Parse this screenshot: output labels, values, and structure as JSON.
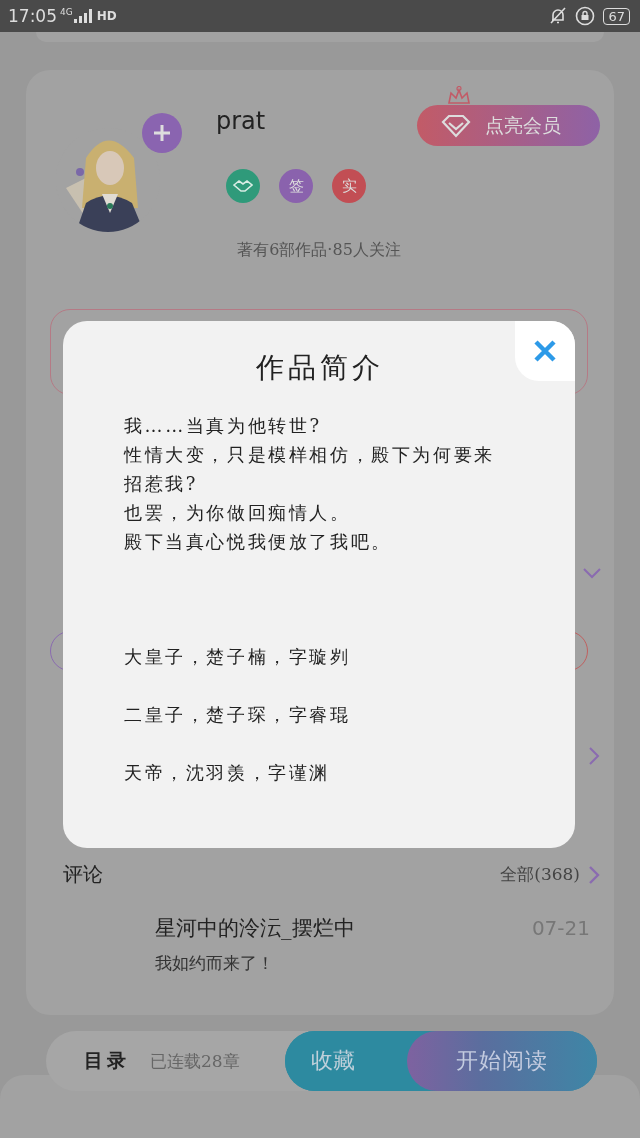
{
  "status_bar": {
    "time": "17:05",
    "network": "4G",
    "hd": "HD",
    "battery": "67"
  },
  "author": {
    "name": "prat",
    "vip_button": "点亮会员",
    "badges": [
      {
        "kind": "icon",
        "color": "#2f9a7a"
      },
      {
        "kind": "text",
        "label": "签",
        "color": "#8a62ad"
      },
      {
        "kind": "text",
        "label": "实",
        "color": "#c24e54"
      }
    ],
    "stats": "著有6部作品·85人关注"
  },
  "intro_dialog": {
    "title": "作品简介",
    "paragraphs": [
      "我……当真为他转世?",
      "性情大变，只是模样相仿，殿下为何要来招惹我?",
      "也罢，为你做回痴情人。",
      "殿下当真心悦我便放了我吧。"
    ],
    "characters": [
      "大皇子，楚子楠，字璇刿",
      "二皇子，楚子琛，字睿琨",
      "天帝，沈羽羡，字谨渊"
    ]
  },
  "comments": {
    "title": "评论",
    "all_link": "全部(368)",
    "items": [
      {
        "user": "星河中的泠沄_摆烂中",
        "date": "07-21",
        "text": "我如约而来了！"
      }
    ]
  },
  "bottom_bar": {
    "catalog": "目录",
    "chapters": "已连载28章",
    "collect_button": "收藏",
    "read_button": "开始阅读"
  }
}
